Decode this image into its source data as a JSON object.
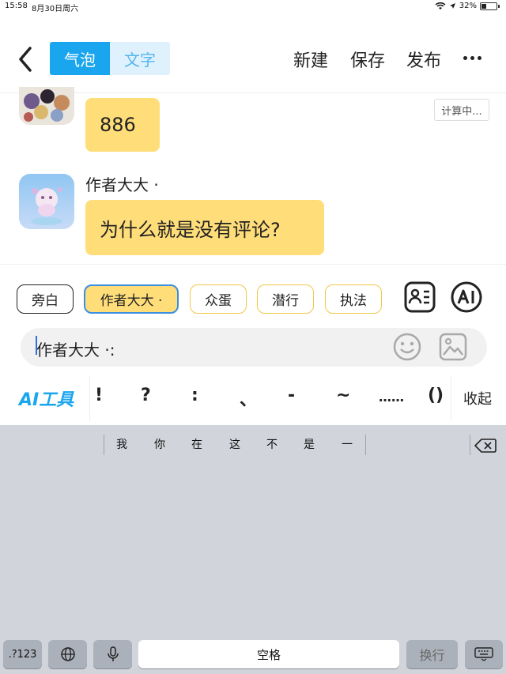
{
  "status": {
    "time": "15:58",
    "date": "8月30日周六",
    "battery": "32%"
  },
  "nav": {
    "tab_bubble": "气泡",
    "tab_text": "文字",
    "new": "新建",
    "save": "保存",
    "publish": "发布"
  },
  "messages": [
    {
      "text": "886"
    },
    {
      "author": "作者大大 ·",
      "text": "为什么就是没有评论?"
    }
  ],
  "calc_badge": "计算中...",
  "roles": [
    "旁白",
    "作者大大 ·",
    "众蛋",
    "潜行",
    "执法"
  ],
  "input": {
    "value": "作者大大 ·:"
  },
  "tools": {
    "ai_label": "AI工具",
    "punct": [
      "!",
      "?",
      ":",
      "、",
      "-",
      "~",
      "……",
      "()"
    ],
    "collapse": "收起"
  },
  "keyboard": {
    "suggestions": [
      "我",
      "你",
      "在",
      "这",
      "不",
      "是",
      "一"
    ],
    "keys": {
      "num": ".?123",
      "space": "空格",
      "return": "换行"
    }
  },
  "colors": {
    "accent": "#1aa6ee",
    "bubble": "#ffde7a",
    "chip_border": "#f1c84a"
  }
}
